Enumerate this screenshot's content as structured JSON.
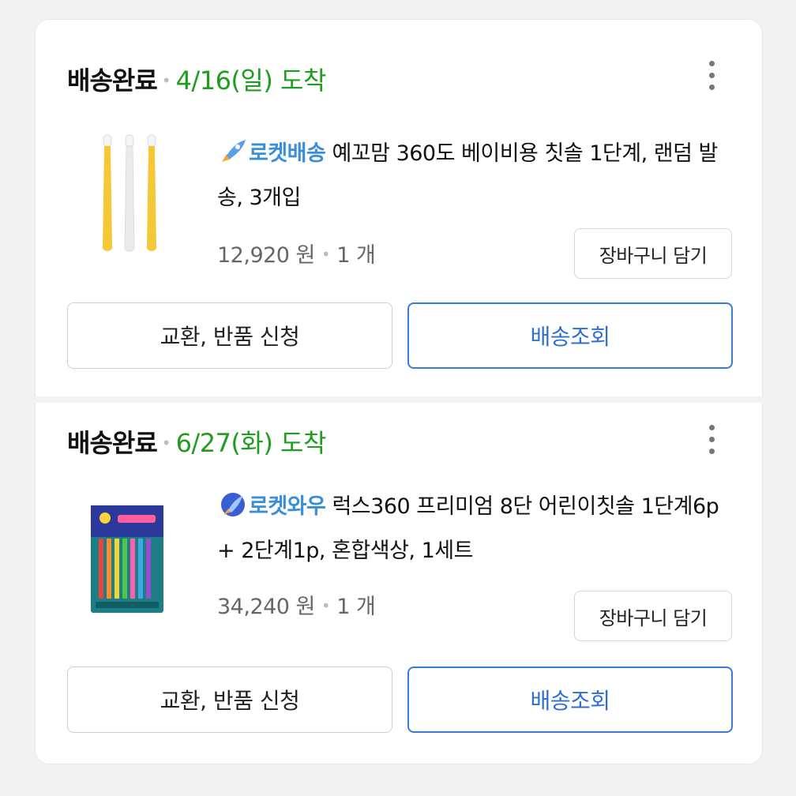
{
  "orders": [
    {
      "status": "배송완료",
      "arrival": "4/16(일) 도착",
      "badge": "로켓배송",
      "badge_color": "#3b8fd9",
      "product_name": "예꼬맘 360도 베이비용 칫솔 1단계, 랜덤 발송, 3개입",
      "price": "12,920 원",
      "quantity": "1 개",
      "cart_button": "장바구니 담기",
      "return_button": "교환, 반품 신청",
      "track_button": "배송조회",
      "thumbnail_icon": "toothbrush-3pack-image"
    },
    {
      "status": "배송완료",
      "arrival": "6/27(화) 도착",
      "badge": "로켓와우",
      "badge_color": "#3b8fd9",
      "product_name": "럭스360 프리미엄 8단 어린이칫솔 1단계6p + 2단계1p, 혼합색상, 1세트",
      "price": "34,240 원",
      "quantity": "1 개",
      "cart_button": "장바구니 담기",
      "return_button": "교환, 반품 신청",
      "track_button": "배송조회",
      "thumbnail_icon": "toothbrush-set-package-image"
    }
  ],
  "colors": {
    "arrival_green": "#1f9d1f",
    "accent_blue": "#2f6fd0"
  }
}
